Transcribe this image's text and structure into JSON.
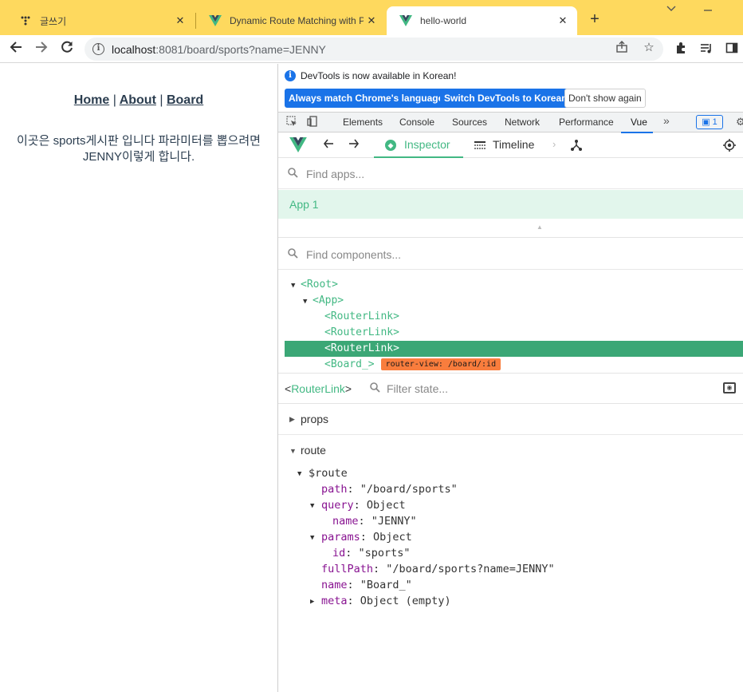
{
  "browser": {
    "tabs": [
      {
        "title": "글쓰기",
        "favicon": "dots-favicon-icon"
      },
      {
        "title": "Dynamic Route Matching with P",
        "favicon": "vue-favicon-icon"
      },
      {
        "title": "hello-world",
        "favicon": "vue-favicon-icon"
      }
    ],
    "new_tab": "+",
    "url_host": "localhost",
    "url_rest": ":8081/board/sports?name=JENNY"
  },
  "page": {
    "nav": {
      "home": "Home",
      "about": "About",
      "board": "Board",
      "sep1": "|",
      "sep2": "|"
    },
    "board_text": "이곳은 sports게시판 입니다 파라미터를 뽑으려면 JENNY이렇게 합니다."
  },
  "devtools": {
    "info_message": "DevTools is now available in Korean!",
    "buttons": {
      "always_match": "Always match Chrome's language",
      "switch": "Switch DevTools to Korean",
      "dont_show": "Don't show again"
    },
    "tabs": [
      "Elements",
      "Console",
      "Sources",
      "Network",
      "Performance",
      "Vue"
    ],
    "issues_count": "1",
    "vue": {
      "inspector": "Inspector",
      "timeline": "Timeline",
      "find_apps_placeholder": "Find apps...",
      "app_name": "App 1",
      "find_components_placeholder": "Find components...",
      "tree": {
        "root": "<Root>",
        "app": "<App>",
        "link1": "<RouterLink>",
        "link2": "<RouterLink>",
        "link3": "<RouterLink>",
        "board": "<Board_>",
        "router_badge": "router-view: /board/:id"
      },
      "selected_component": {
        "open": "<",
        "name": "RouterLink",
        "close": ">"
      },
      "filter_placeholder": "Filter state...",
      "sections": {
        "props": "props",
        "route": "route"
      },
      "route": {
        "root_key": "$route",
        "path_key": "path",
        "path_val": "\"/board/sports\"",
        "query_key": "query",
        "query_val": "Object",
        "name_q_key": "name",
        "name_q_val": "\"JENNY\"",
        "params_key": "params",
        "params_val": "Object",
        "id_key": "id",
        "id_val": "\"sports\"",
        "fullpath_key": "fullPath",
        "fullpath_val": "\"/board/sports?name=JENNY\"",
        "name_key": "name",
        "name_val": "\"Board_\"",
        "meta_key": "meta",
        "meta_val": "Object (empty)"
      }
    }
  },
  "colors": {
    "vue_green": "#42b883",
    "chrome_yellow": "#fed95e",
    "chrome_blue": "#1a73e8",
    "badge_orange": "#f97d3d"
  }
}
